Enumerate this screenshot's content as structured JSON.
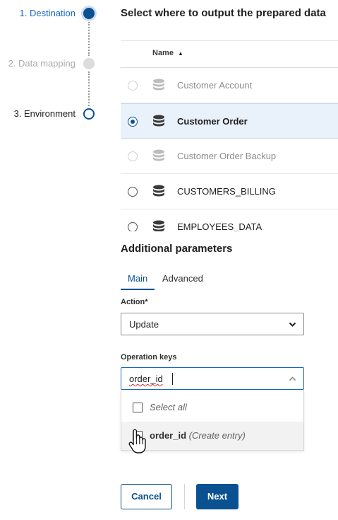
{
  "stepper": {
    "steps": [
      {
        "label": "1. Destination",
        "state": "current"
      },
      {
        "label": "2. Data mapping",
        "state": "disabled"
      },
      {
        "label": "3. Environment",
        "state": "upcoming"
      }
    ]
  },
  "destination": {
    "heading": "Select where to output the prepared data",
    "column_name": "Name",
    "sort_glyph": "▲",
    "rows": [
      {
        "label": "Customer Account",
        "state": "disabled",
        "selected": false
      },
      {
        "label": "Customer Order",
        "state": "selected",
        "selected": true
      },
      {
        "label": "Customer Order Backup",
        "state": "disabled",
        "selected": false
      },
      {
        "label": "CUSTOMERS_BILLING",
        "state": "normal",
        "selected": false
      },
      {
        "label": "EMPLOYEES_DATA",
        "state": "normal",
        "selected": false
      }
    ]
  },
  "params": {
    "title": "Additional parameters",
    "tabs": [
      {
        "label": "Main",
        "active": true
      },
      {
        "label": "Advanced",
        "active": false
      }
    ],
    "action_label": "Action*",
    "action_value": "Update",
    "keys_label": "Operation keys",
    "keys_input": "order_id",
    "options": {
      "select_all": "Select all",
      "entry_value": "order_id",
      "entry_hint": "(Create entry)"
    }
  },
  "footer": {
    "cancel": "Cancel",
    "next": "Next"
  },
  "colors": {
    "accent": "#0a5191",
    "link": "#1667c2",
    "selected_row": "#e9f1fb"
  }
}
